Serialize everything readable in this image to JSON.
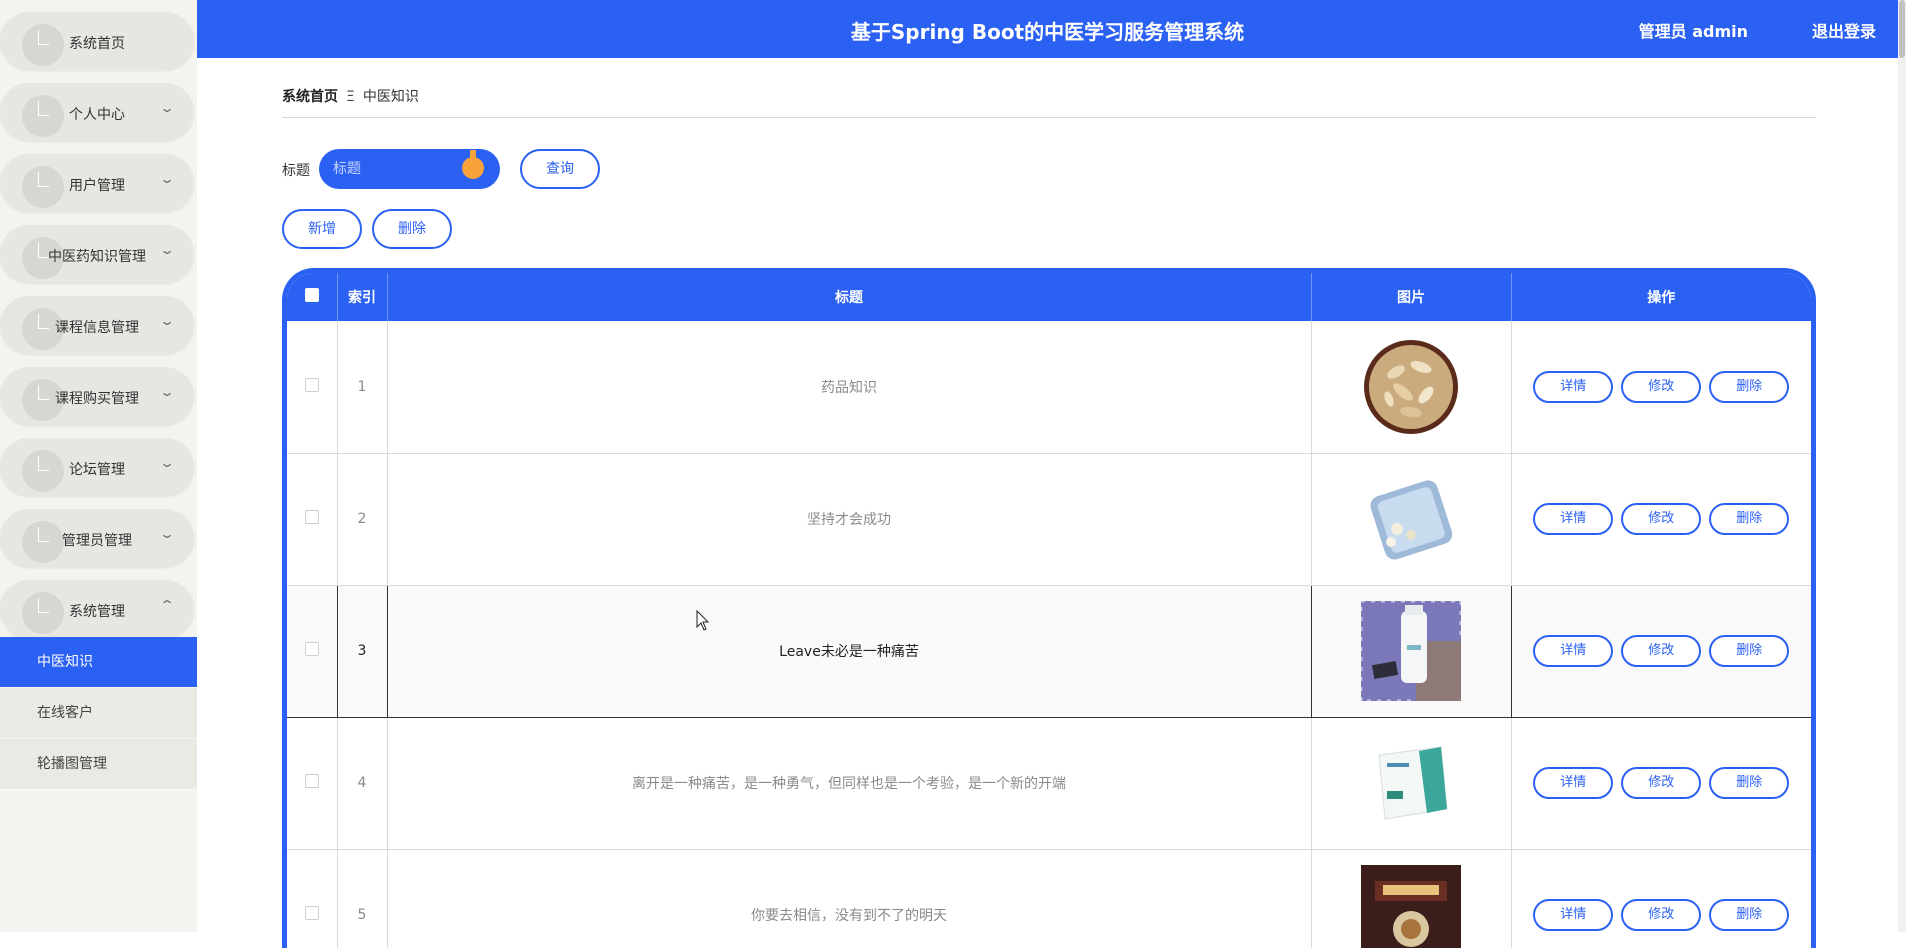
{
  "header": {
    "title": "基于Spring Boot的中医学习服务管理系统",
    "user": "管理员 admin",
    "logout": "退出登录"
  },
  "sidebar": {
    "items": [
      {
        "label": "系统首页",
        "chevron": ""
      },
      {
        "label": "个人中心",
        "chevron": "⌄"
      },
      {
        "label": "用户管理",
        "chevron": "⌄"
      },
      {
        "label": "中医药知识管理",
        "chevron": "⌄"
      },
      {
        "label": "课程信息管理",
        "chevron": "⌄"
      },
      {
        "label": "课程购买管理",
        "chevron": "⌄"
      },
      {
        "label": "论坛管理",
        "chevron": "⌄"
      },
      {
        "label": "管理员管理",
        "chevron": "⌄"
      },
      {
        "label": "系统管理",
        "chevron": "⌃"
      }
    ],
    "submenu": [
      {
        "label": "中医知识",
        "active": true
      },
      {
        "label": "在线客户",
        "active": false
      },
      {
        "label": "轮播图管理",
        "active": false
      }
    ]
  },
  "breadcrumb": {
    "home": "系统首页",
    "separator": "Ξ",
    "current": "中医知识"
  },
  "search": {
    "label": "标题",
    "placeholder": "标题",
    "button": "查询"
  },
  "actions": {
    "add": "新增",
    "delete": "删除"
  },
  "table": {
    "columns": [
      "",
      "索引",
      "标题",
      "图片",
      "操作"
    ],
    "ops": {
      "detail": "详情",
      "edit": "修改",
      "delete": "删除"
    },
    "rows": [
      {
        "index": "1",
        "title": "药品知识",
        "image": "herb-root-bowl"
      },
      {
        "index": "2",
        "title": "坚持才会成功",
        "image": "pill-organizer-box"
      },
      {
        "index": "3",
        "title": "Leave未必是一种痛苦",
        "image": "medicine-bottle-on-cloth"
      },
      {
        "index": "4",
        "title": "离开是一种痛苦，是一种勇气，但同样也是一个考验，是一个新的开端",
        "image": "medicine-box-teal"
      },
      {
        "index": "5",
        "title": "你要去相信，没有到不了的明天",
        "image": "medicine-box-dark"
      }
    ]
  },
  "colors": {
    "primary": "#2b61f2",
    "accent_orange": "#f7a23b",
    "sidebar_bg": "#f3f3ef"
  }
}
